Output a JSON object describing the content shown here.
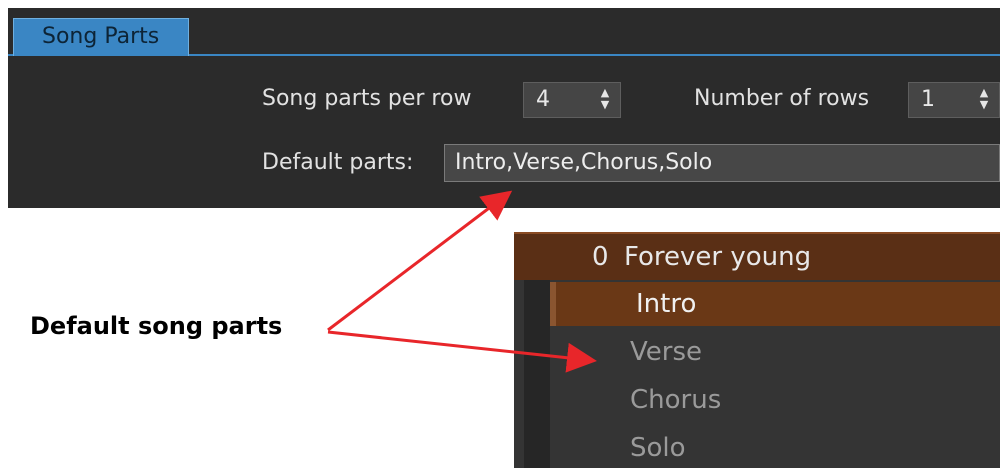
{
  "tab": {
    "label": "Song Parts"
  },
  "settings": {
    "parts_per_row_label": "Song parts per row",
    "parts_per_row_value": "4",
    "rows_label": "Number of rows",
    "rows_value": "1",
    "default_parts_label": "Default parts:",
    "default_parts_value": "Intro,Verse,Chorus,Solo"
  },
  "song": {
    "number": "0",
    "title": "Forever young",
    "parts": [
      "Intro",
      "Verse",
      "Chorus",
      "Solo"
    ]
  },
  "annotation": {
    "text": "Default song parts",
    "color": "#e8262a"
  },
  "colors": {
    "tab_accent": "#3a86c4",
    "panel_bg": "#2b2b2b",
    "song_header_bg": "#5a2f15",
    "active_part_bg": "#6a3816"
  },
  "icons": {
    "spinner": "up-down-arrows-icon"
  }
}
